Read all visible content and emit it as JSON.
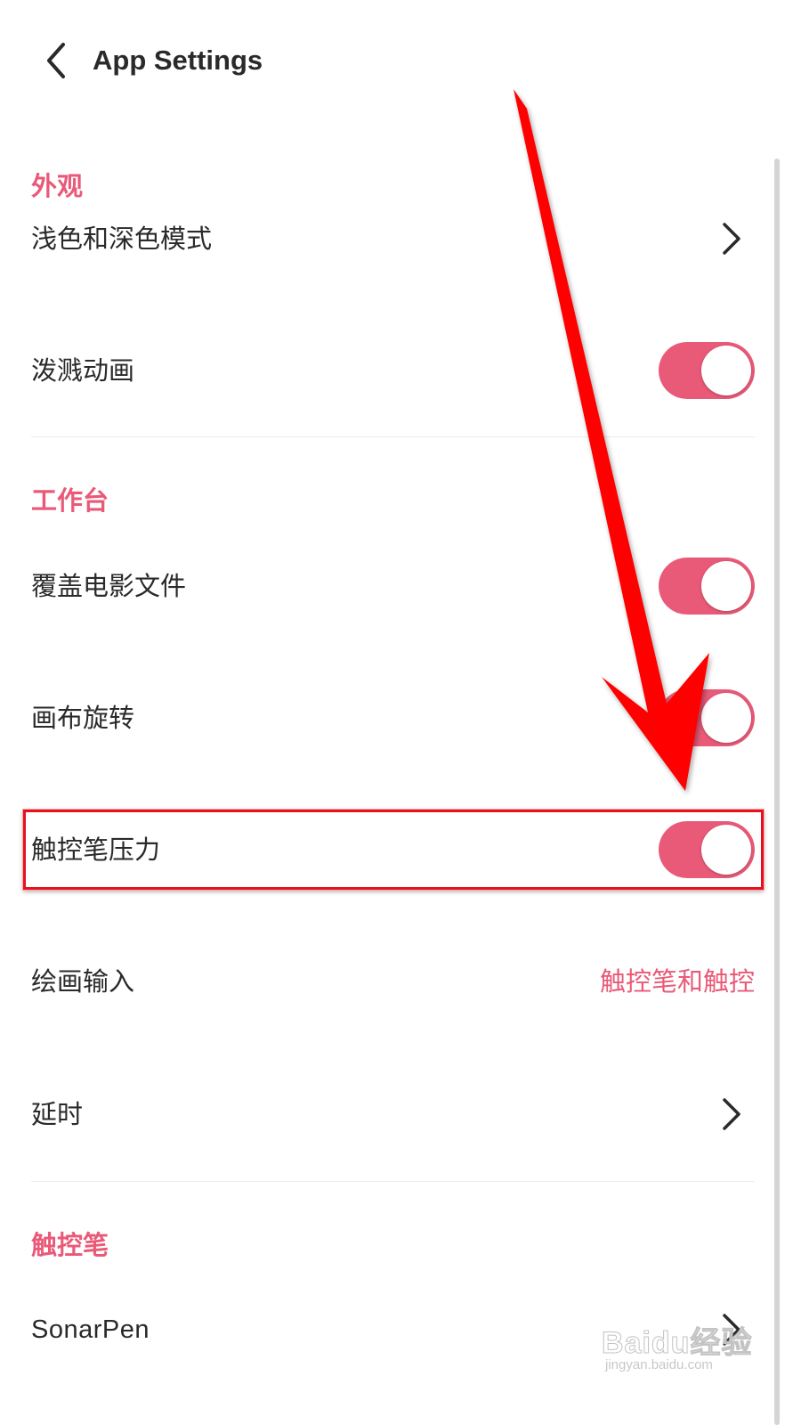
{
  "colors": {
    "accent": "#e95a78",
    "text": "#2a2a2a",
    "arrow": "#ff0000",
    "highlight_border": "#e8101c",
    "toggle_on": "#e95a78"
  },
  "header": {
    "title": "App Settings",
    "back_icon": "chevron-left-icon"
  },
  "sections": {
    "appearance": {
      "title": "外观",
      "rows": {
        "theme": {
          "label": "浅色和深色模式",
          "control": "chevron-right-icon"
        },
        "splash": {
          "label": "泼溅动画",
          "control": "toggle",
          "on": true
        }
      }
    },
    "workspace": {
      "title": "工作台",
      "rows": {
        "overwrite_movie": {
          "label": "覆盖电影文件",
          "control": "toggle",
          "on": true
        },
        "canvas_rotation": {
          "label": "画布旋转",
          "control": "toggle",
          "on": true
        },
        "stylus_pressure": {
          "label": "触控笔压力",
          "control": "toggle",
          "on": true
        },
        "drawing_input": {
          "label": "绘画输入",
          "value": "触控笔和触控"
        },
        "latency": {
          "label": "延时",
          "control": "chevron-right-icon"
        }
      }
    },
    "stylus": {
      "title": "触控笔",
      "rows": {
        "sonarpen": {
          "label": "SonarPen",
          "control": "chevron-right-icon"
        }
      }
    }
  },
  "annotation": {
    "arrow_icon": "red-arrow-icon",
    "highlighted_row": "触控笔压力"
  },
  "watermark": {
    "main": "Baidu经验",
    "sub": "jingyan.baidu.com"
  }
}
